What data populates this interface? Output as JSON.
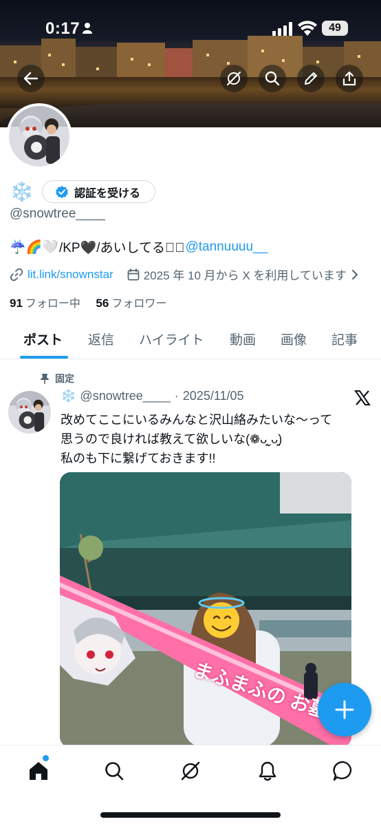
{
  "status_bar": {
    "time": "0:17",
    "battery": "49"
  },
  "profile": {
    "name_emoji": "❄️",
    "verify_label": "認証を受ける",
    "handle": "@snowtree____",
    "bio_emojis": "☔️🌈🤍",
    "bio_text": "/KP🖤/あいしてるෆ゙",
    "bio_mention": "@tannuuuu__",
    "link": "lit.link/snownstar",
    "joined": "2025 年 10 月から X を利用しています",
    "following_count": "91",
    "following_label": "フォロー中",
    "followers_count": "56",
    "followers_label": "フォロワー"
  },
  "tabs": [
    "ポスト",
    "返信",
    "ハイライト",
    "動画",
    "画像",
    "記事"
  ],
  "post": {
    "pinned_label": "固定",
    "name_emoji": "❄️",
    "handle": "@snowtree____",
    "separator": "·",
    "date": "2025/11/05",
    "text_lines": [
      "改めてここにいるみんなと沢山絡みたいな〜って",
      "思うので良ければ教えて欲しいな(❁ᴗ͈ˬᴗ͈)",
      "私のも下に繋げておきます!!"
    ],
    "image_banner_text": "まふまふの お墓に"
  },
  "icons": {
    "back": "back-arrow-icon",
    "grok": "grok-icon",
    "search": "search-icon",
    "edit": "pencil-icon",
    "share": "share-icon",
    "pin": "pin-icon",
    "x": "x-logo-icon",
    "compose": "plus-icon",
    "home": "home-icon",
    "notifications": "bell-icon",
    "messages": "message-icon",
    "link": "link-icon",
    "calendar": "calendar-icon",
    "verified": "verified-badge-icon"
  },
  "colors": {
    "accent": "#1d9bf0",
    "text": "#0f1419",
    "secondary": "#536471"
  }
}
